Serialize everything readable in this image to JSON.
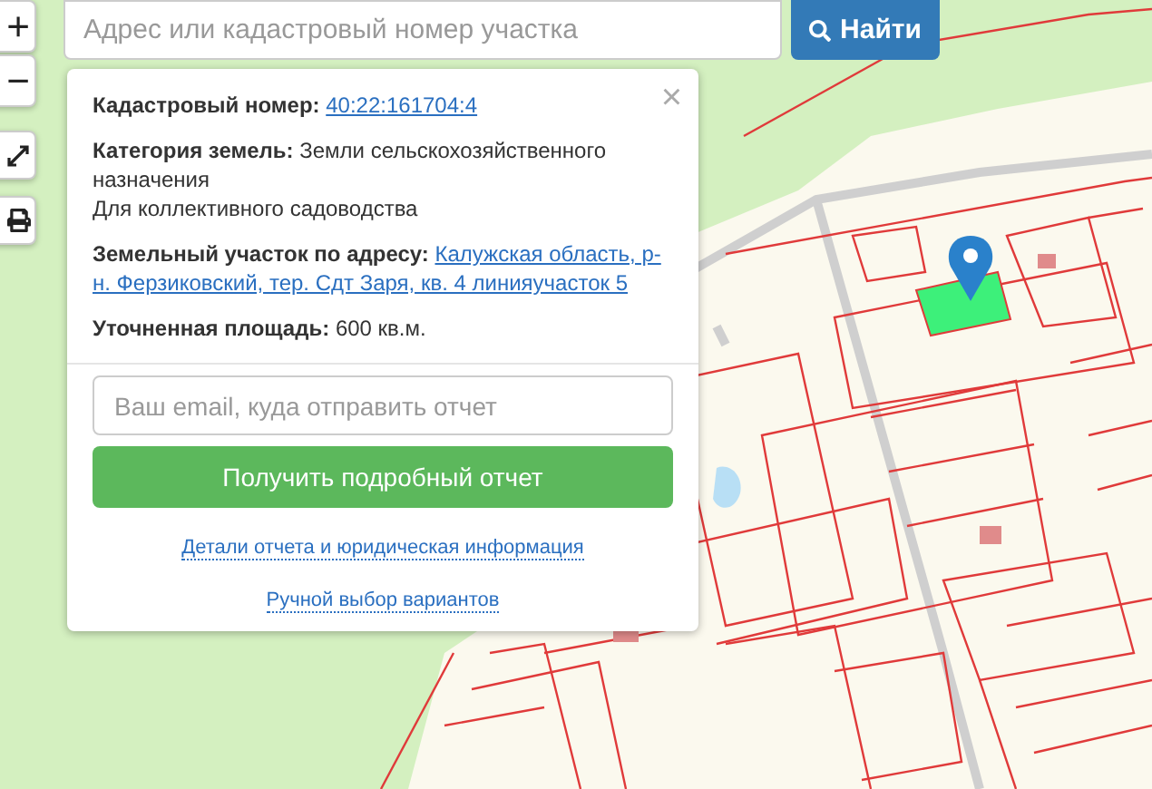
{
  "map_controls": {
    "zoom_in": "+",
    "zoom_out": "−"
  },
  "search": {
    "placeholder": "Адрес или кадастровый номер участка",
    "button": "Найти"
  },
  "popup": {
    "close": "×",
    "fields": [
      {
        "kind": "link",
        "label": "Кадастровый номер:",
        "value": "40:22:161704:4"
      },
      {
        "kind": "text",
        "label": "Категория земель:",
        "value": "Земли сельскохозяйственного назначения",
        "note": "Для коллективного садоводства"
      },
      {
        "kind": "link",
        "label": "Земельный участок по адресу:",
        "value": "Калужская область, р-",
        "continuation": "н. Ферзиковский, тер. Сдт Заря, кв. 4 линияучасток 5"
      },
      {
        "kind": "text",
        "label": "Уточненная площадь:",
        "value": "600 кв.м."
      }
    ],
    "email_placeholder": "Ваш email, куда отправить отчет",
    "submit": "Получить подробный отчет",
    "links": [
      "Детали отчета и юридическая информация",
      "Ручной выбор вариантов"
    ]
  }
}
